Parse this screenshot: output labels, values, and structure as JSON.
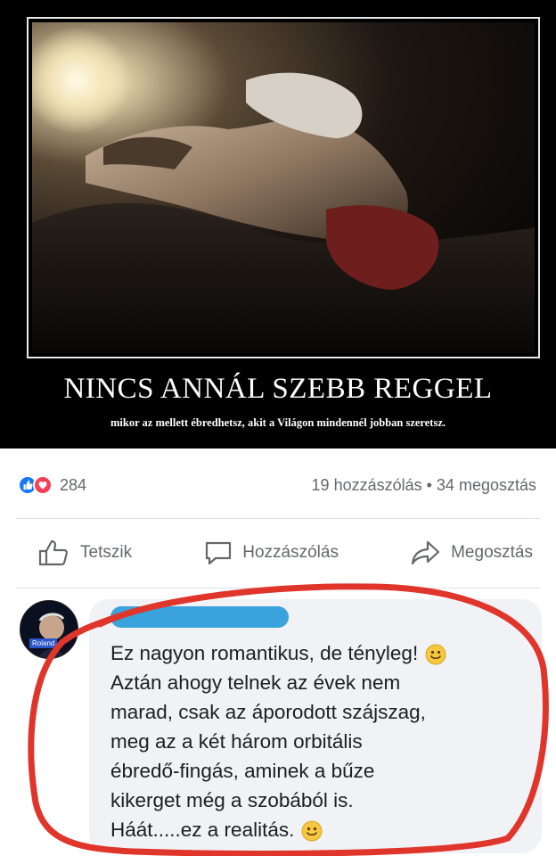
{
  "poster": {
    "title": "NINCS ANNÁL SZEBB REGGEL",
    "subtitle": "mikor az mellett ébredhetsz, akit a Világon mindennél jobban szeretsz."
  },
  "stats": {
    "reaction_count": "284",
    "comments_shares": "19 hozzászólás • 34 megosztás"
  },
  "actions": {
    "like": "Tetszik",
    "comment": "Hozzászólás",
    "share": "Megosztás"
  },
  "comment": {
    "avatar_label": "Roland",
    "lines": [
      "Ez nagyon romantikus, de tényleg!",
      "Aztán ahogy telnek az évek nem",
      "marad, csak az áporodott szájszag,",
      "meg az a két három orbitális",
      "ébredő-fingás, aminek a bűze",
      "kikerget még a szobából is.",
      "Háát.....ez a realitás."
    ]
  },
  "colors": {
    "like": "#1877f2",
    "love": "#f33e58",
    "secondary_text": "#65676b",
    "bubble": "#f0f2f5",
    "highlight": "#e0352b",
    "redaction": "#3aa2dc"
  }
}
